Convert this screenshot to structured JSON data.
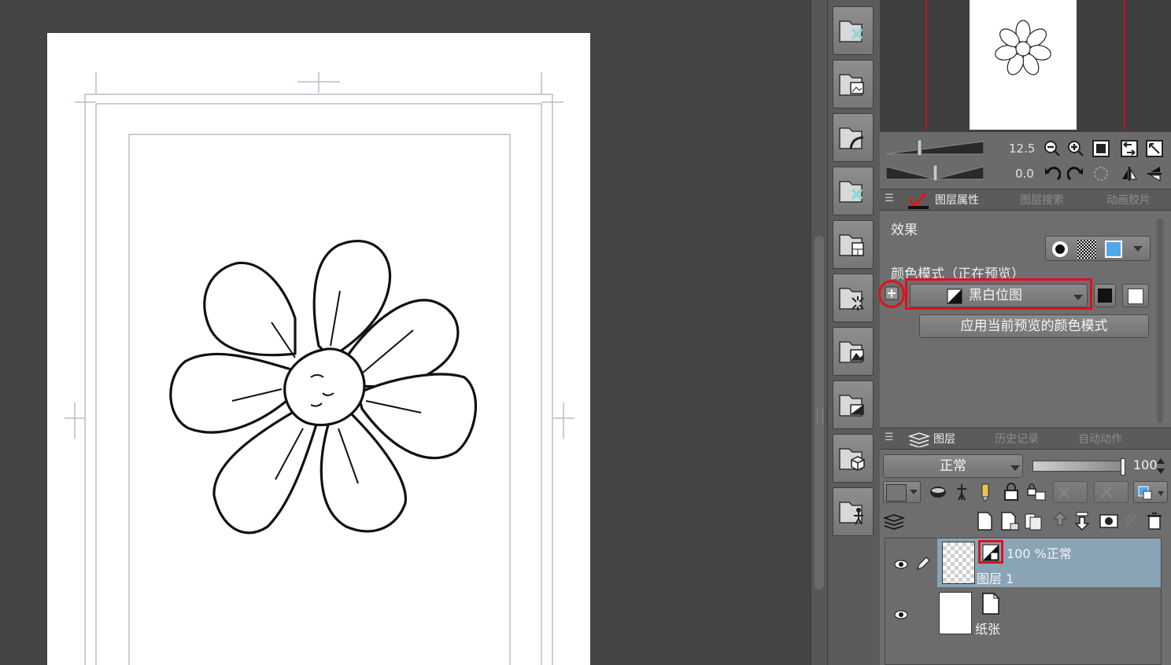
{
  "navigator": {
    "zoom_value": "12.5",
    "rotation_value": "0.0"
  },
  "layer_property_tabs": [
    {
      "label": "图层属性",
      "active": true
    },
    {
      "label": "图层搜索",
      "active": false
    },
    {
      "label": "动画胶片",
      "active": false
    }
  ],
  "layer_property": {
    "effect_label": "效果",
    "color_mode_label": "颜色模式（正在预览）",
    "color_mode_value": "黑白位图",
    "apply_button": "应用当前预览的颜色模式"
  },
  "layer_tabs": [
    {
      "label": "图层",
      "active": true
    },
    {
      "label": "历史记录",
      "active": false
    },
    {
      "label": "自动动作",
      "active": false
    }
  ],
  "layers": {
    "blend_mode": "正常",
    "opacity": "100",
    "items": [
      {
        "opacity_mode": "100 %正常",
        "name": "图层 1",
        "selected": true
      },
      {
        "name": "纸张",
        "selected": false
      }
    ]
  },
  "colors": {
    "background": "#444444",
    "panel": "#6e6e6e",
    "highlight": "#e0101a",
    "selected_layer": "#8aa4b6"
  }
}
